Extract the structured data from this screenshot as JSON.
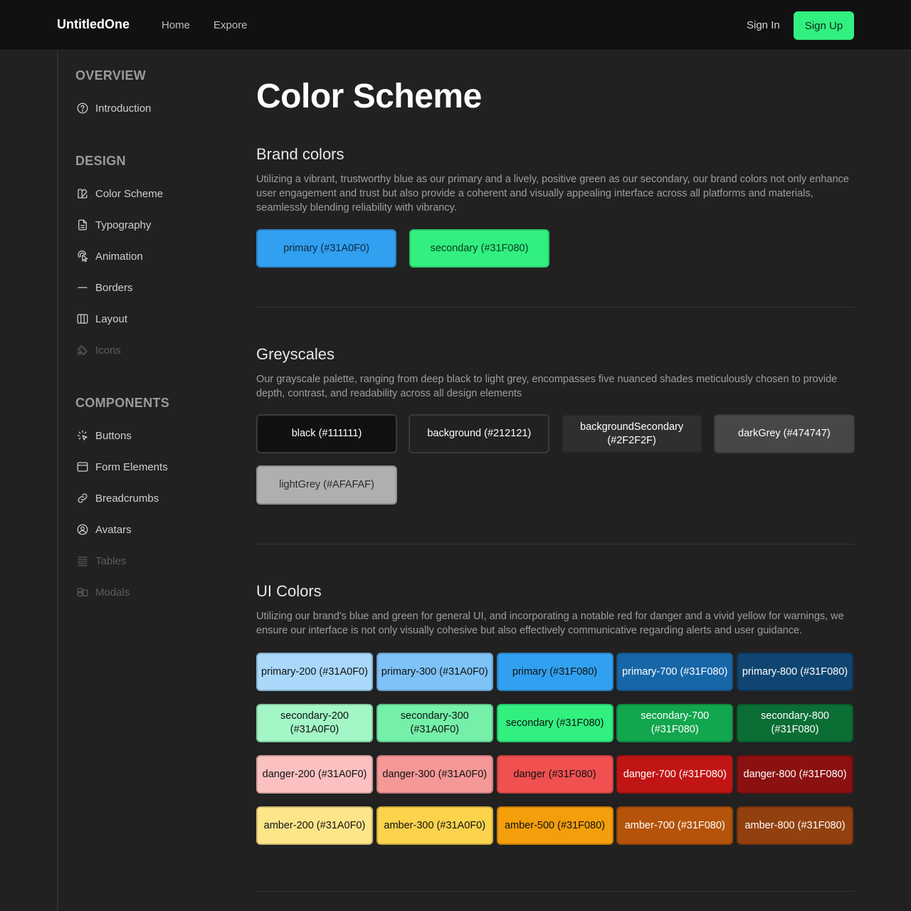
{
  "header": {
    "brand": "UntitledOne",
    "nav": [
      "Home",
      "Expore"
    ],
    "sign_in": "Sign In",
    "sign_up": "Sign Up"
  },
  "sidebar": {
    "sections": [
      {
        "heading": "OVERVIEW",
        "items": [
          {
            "label": "Introduction",
            "icon": "question-circle-icon",
            "disabled": false
          }
        ]
      },
      {
        "heading": "DESIGN",
        "items": [
          {
            "label": "Color Scheme",
            "icon": "palette-icon",
            "disabled": false
          },
          {
            "label": "Typography",
            "icon": "document-icon",
            "disabled": false
          },
          {
            "label": "Animation",
            "icon": "tap-animation-icon",
            "disabled": false
          },
          {
            "label": "Borders",
            "icon": "minus-icon",
            "disabled": false
          },
          {
            "label": "Layout",
            "icon": "columns-icon",
            "disabled": false
          },
          {
            "label": "Icons",
            "icon": "puzzle-icon",
            "disabled": true
          }
        ]
      },
      {
        "heading": "COMPONENTS",
        "items": [
          {
            "label": "Buttons",
            "icon": "cursor-click-icon",
            "disabled": false
          },
          {
            "label": "Form Elements",
            "icon": "browser-window-icon",
            "disabled": false
          },
          {
            "label": "Breadcrumbs",
            "icon": "link-icon",
            "disabled": false
          },
          {
            "label": "Avatars",
            "icon": "user-circle-icon",
            "disabled": false
          },
          {
            "label": "Tables",
            "icon": "table-lines-icon",
            "disabled": true
          },
          {
            "label": "Modals",
            "icon": "modal-layout-icon",
            "disabled": true
          }
        ]
      }
    ]
  },
  "main": {
    "title": "Color Scheme",
    "brand_section": {
      "title": "Brand colors",
      "description": "Utilizing a vibrant, trustworthy blue as our primary and a lively, positive green as our secondary, our brand colors not only enhance user engagement and trust but also provide a coherent and visually appealing interface across all platforms and materials, seamlessly blending reliability with vibrancy.",
      "swatches": [
        {
          "label": "primary (#31A0F0)",
          "bg": "#31A0F0",
          "fg": "#0d2a40"
        },
        {
          "label": "secondary (#31F080)",
          "bg": "#31F080",
          "fg": "#0c3a22"
        }
      ]
    },
    "grey_section": {
      "title": "Greyscales",
      "description": "Our grayscale palette, ranging from deep black to light grey, encompasses five nuanced shades meticulously chosen to provide depth, contrast, and readability across all design elements",
      "swatches": [
        {
          "label": "black (#111111)",
          "bg": "#111111",
          "fg": "#ffffff"
        },
        {
          "label": "background (#212121)",
          "bg": "#212121",
          "fg": "#ffffff"
        },
        {
          "label": "backgroundSecondary (#2F2F2F)",
          "bg": "#2F2F2F",
          "fg": "#ffffff"
        },
        {
          "label": "darkGrey (#474747)",
          "bg": "#474747",
          "fg": "#ffffff"
        },
        {
          "label": "lightGrey (#AFAFAF)",
          "bg": "#AFAFAF",
          "fg": "#2a2a2a"
        }
      ]
    },
    "ui_section": {
      "title": "UI Colors",
      "description": "Utilizing our brand's blue and green for general UI, and incorporating a notable red for danger and a vivid yellow for warnings, we ensure our interface is not only visually cohesive but also effectively communicative regarding alerts and user guidance.",
      "rows": [
        [
          {
            "label": "primary-200 (#31A0F0)",
            "bg": "#a9d8fb",
            "fg": "#111111"
          },
          {
            "label": "primary-300 (#31A0F0)",
            "bg": "#7ec3f7",
            "fg": "#111111"
          },
          {
            "label": "primary (#31F080)",
            "bg": "#31A0F0",
            "fg": "#111111"
          },
          {
            "label": "primary-700 (#31F080)",
            "bg": "#1766a8",
            "fg": "#ffffff"
          },
          {
            "label": "primary-800 (#31F080)",
            "bg": "#0f4570",
            "fg": "#ffffff"
          }
        ],
        [
          {
            "label": "secondary-200 (#31A0F0)",
            "bg": "#a3f7c6",
            "fg": "#111111"
          },
          {
            "label": "secondary-300 (#31A0F0)",
            "bg": "#75f0a9",
            "fg": "#111111"
          },
          {
            "label": "secondary (#31F080)",
            "bg": "#31F080",
            "fg": "#111111"
          },
          {
            "label": "secondary-700 (#31F080)",
            "bg": "#12a64e",
            "fg": "#ffffff"
          },
          {
            "label": "secondary-800 (#31F080)",
            "bg": "#0b6e35",
            "fg": "#ffffff"
          }
        ],
        [
          {
            "label": "danger-200 (#31A0F0)",
            "bg": "#fbc1c1",
            "fg": "#111111"
          },
          {
            "label": "danger-300 (#31A0F0)",
            "bg": "#f59898",
            "fg": "#111111"
          },
          {
            "label": "danger (#31F080)",
            "bg": "#f05050",
            "fg": "#111111"
          },
          {
            "label": "danger-700 (#31F080)",
            "bg": "#c11515",
            "fg": "#ffffff"
          },
          {
            "label": "danger-800 (#31F080)",
            "bg": "#8b1010",
            "fg": "#ffffff"
          }
        ],
        [
          {
            "label": "amber-200 (#31A0F0)",
            "bg": "#fde68a",
            "fg": "#111111"
          },
          {
            "label": "amber-300 (#31A0F0)",
            "bg": "#fcd34d",
            "fg": "#111111"
          },
          {
            "label": "amber-500 (#31F080)",
            "bg": "#f59e0b",
            "fg": "#111111"
          },
          {
            "label": "amber-700 (#31F080)",
            "bg": "#b45309",
            "fg": "#ffffff"
          },
          {
            "label": "amber-800 (#31F080)",
            "bg": "#92400e",
            "fg": "#ffffff"
          }
        ]
      ]
    }
  }
}
